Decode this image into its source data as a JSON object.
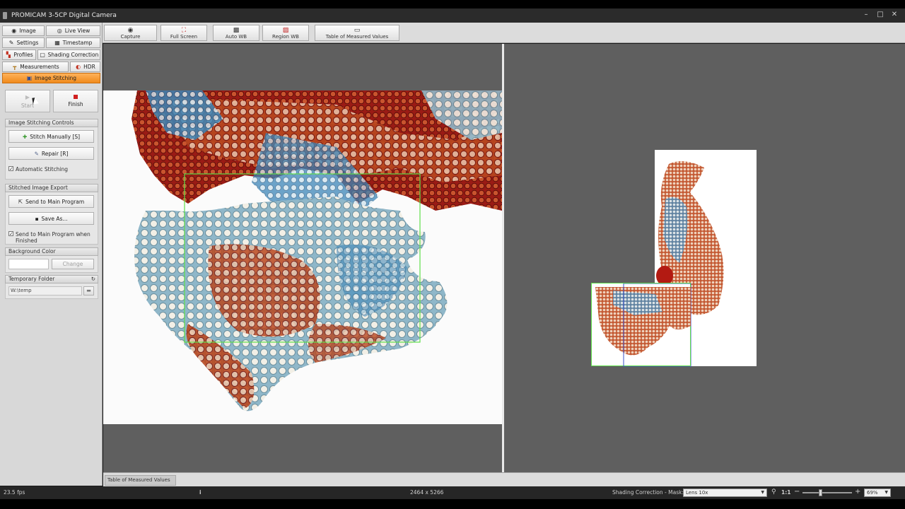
{
  "window": {
    "title": "PROMICAM 3-5CP Digital Camera",
    "controls": [
      "–",
      "□",
      "✕"
    ]
  },
  "nav": {
    "image": "Image",
    "live_view": "Live View",
    "settings": "Settings",
    "timestamp": "Timestamp",
    "profiles": "Profiles",
    "shading_correction": "Shading Correction",
    "measurements": "Measurements",
    "hdr": "HDR",
    "image_stitching": "Image Stitching"
  },
  "stitch": {
    "start": "Start",
    "finish": "Finish",
    "controls_header": "Image Stitching Controls",
    "stitch_manually": "Stitch Manually [S]",
    "repair": "Repair [R]",
    "automatic_stitching": "Automatic Stitching",
    "automatic_checked": true,
    "export_header": "Stitched Image Export",
    "send_to_main": "Send to Main Program",
    "save_as": "Save As...",
    "send_when_finished": "Send to Main Program when Finished",
    "send_when_finished_checked": true,
    "bg_color_header": "Background Color",
    "bg_color_value": "#ffffff",
    "change": "Change",
    "temp_folder_header": "Temporary Folder",
    "temp_folder_path": "W:\\temp"
  },
  "toolbar": {
    "capture": "Capture",
    "full_screen": "Full Screen",
    "auto_wb": "Auto WB",
    "region_wb": "Region WB",
    "table_values": "Table of Measured Values"
  },
  "tabs": {
    "table_values": "Table of Measured Values"
  },
  "status": {
    "fps": "23.5 fps",
    "info_icon": "i",
    "resolution": "2464 x 5266",
    "shading": "Shading Correction - Mask:",
    "lens": "Lens 10x",
    "ratio": "1:1",
    "zoom": "69%",
    "zoom_fraction": 0.35
  },
  "colors": {
    "accent_orange": "#f08a1c",
    "selection_green": "#5fe04a",
    "viewer_bg": "#5f5f5f"
  }
}
